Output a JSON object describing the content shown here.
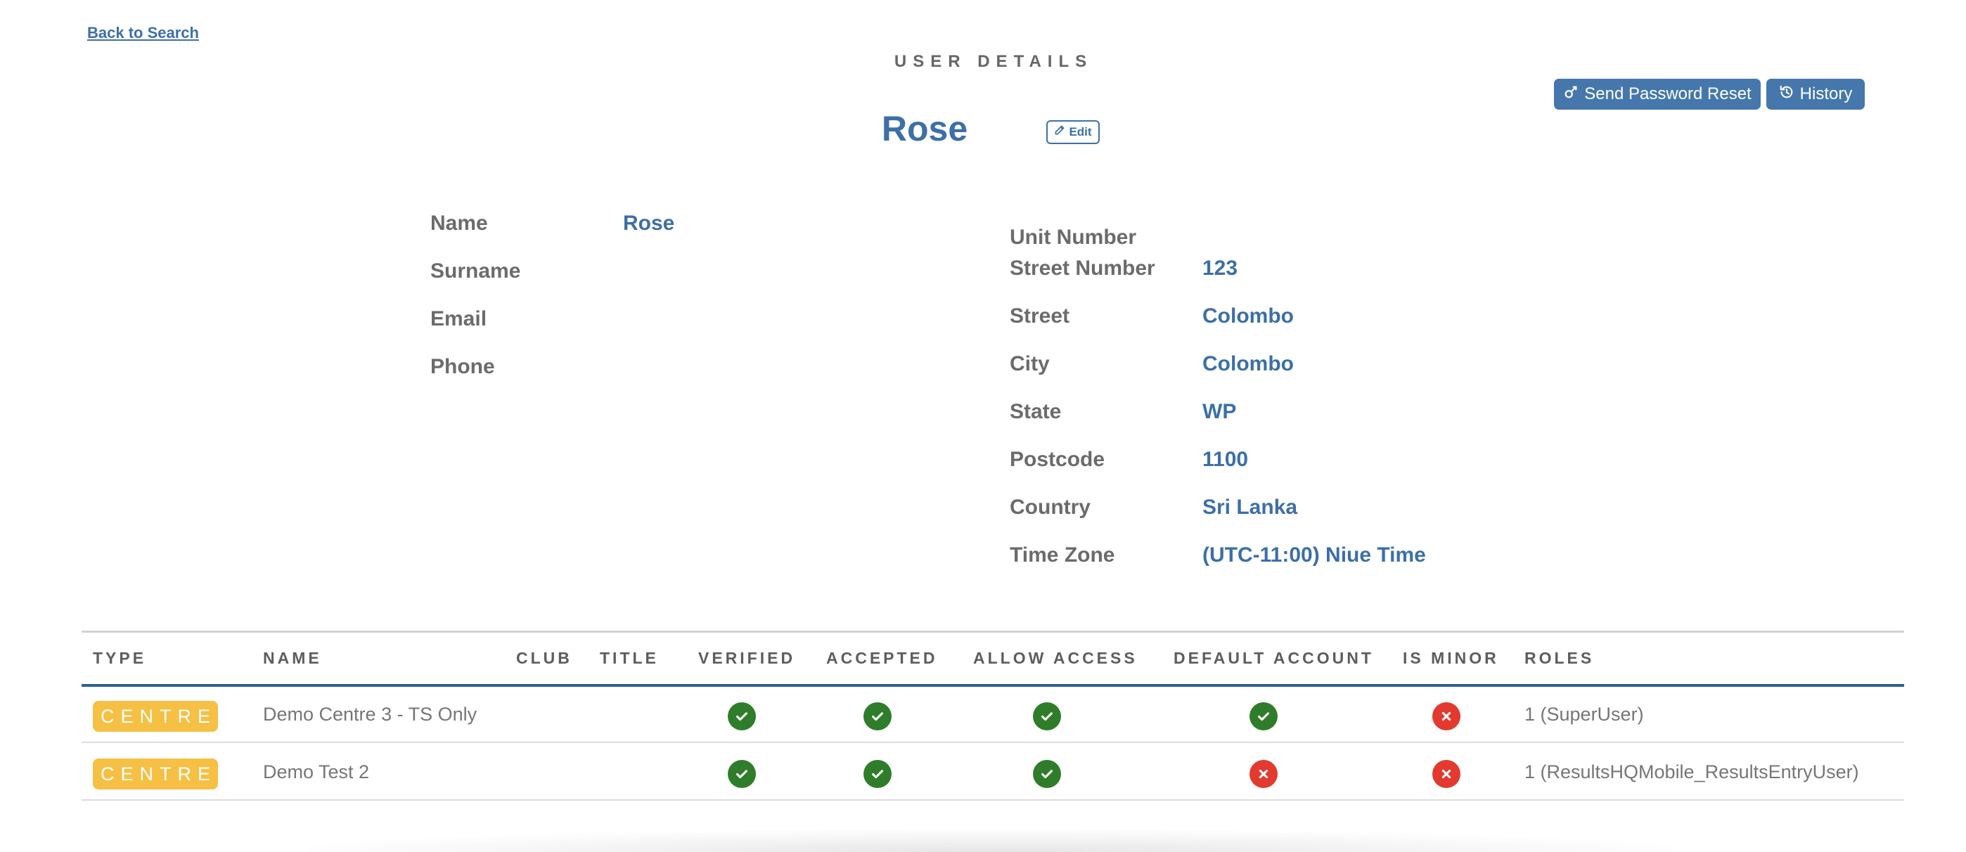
{
  "nav": {
    "back_label": "Back to Search"
  },
  "page": {
    "heading": "USER DETAILS",
    "user_title": "Rose",
    "edit_label": "Edit"
  },
  "actions": {
    "reset_label": "Send Password Reset",
    "history_label": "History"
  },
  "personal": {
    "name_label": "Name",
    "name_value": "Rose",
    "surname_label": "Surname",
    "surname_value": "",
    "email_label": "Email",
    "email_value": "",
    "phone_label": "Phone",
    "phone_value": ""
  },
  "address": {
    "unit_label": "Unit Number",
    "unit_value": "",
    "street_number_label": "Street Number",
    "street_number_value": "123",
    "street_label": "Street",
    "street_value": "Colombo",
    "city_label": "City",
    "city_value": "Colombo",
    "state_label": "State",
    "state_value": "WP",
    "postcode_label": "Postcode",
    "postcode_value": "1100",
    "country_label": "Country",
    "country_value": "Sri Lanka",
    "timezone_label": "Time Zone",
    "timezone_value": "(UTC-11:00) Niue Time"
  },
  "table": {
    "headers": {
      "type": "TYPE",
      "name": "NAME",
      "club": "CLUB",
      "title": "TITLE",
      "verified": "VERIFIED",
      "accepted": "ACCEPTED",
      "allow_access": "ALLOW ACCESS",
      "default_account": "DEFAULT ACCOUNT",
      "is_minor": "IS MINOR",
      "roles": "ROLES"
    },
    "rows": [
      {
        "type": "CENTRE",
        "name": "Demo Centre 3 - TS Only",
        "club": "",
        "title": "",
        "verified": true,
        "accepted": true,
        "allow_access": true,
        "default_account": true,
        "is_minor": false,
        "roles": "1 (SuperUser)"
      },
      {
        "type": "CENTRE",
        "name": "Demo Test 2",
        "club": "",
        "title": "",
        "verified": true,
        "accepted": true,
        "allow_access": true,
        "default_account": false,
        "is_minor": false,
        "roles": "1 (ResultsHQMobile_ResultsEntryUser)"
      }
    ]
  },
  "colors": {
    "accent_blue": "#3d6fa8",
    "button_blue": "#4677ac",
    "badge_yellow": "#f5c043",
    "check_green": "#2f7d2a",
    "cross_red": "#e23a2f"
  },
  "icons": {
    "check": "check-icon",
    "cross": "x-icon",
    "edit": "pencil-icon",
    "reset": "key-icon",
    "history": "history-icon"
  }
}
